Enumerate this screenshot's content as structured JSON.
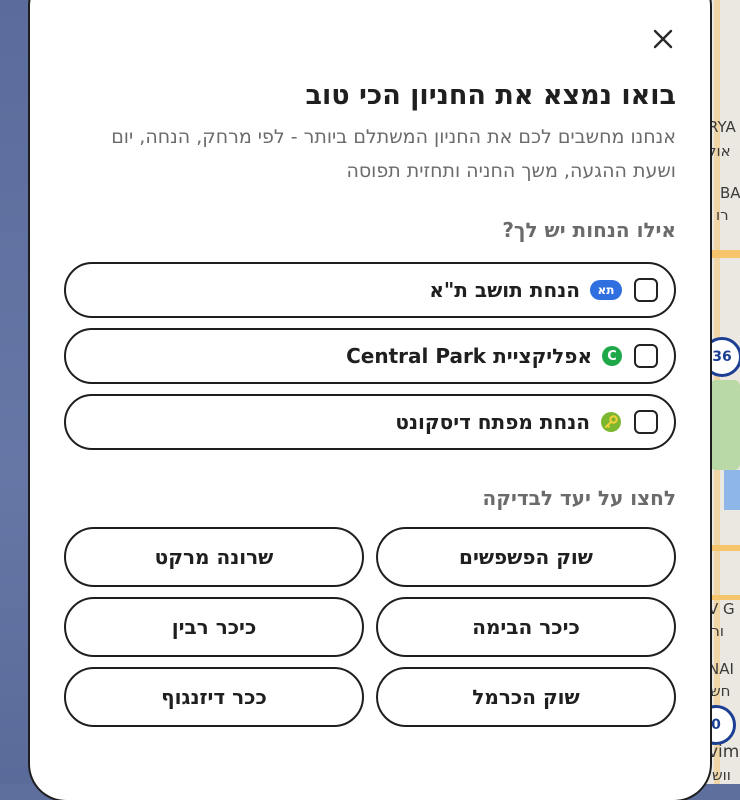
{
  "map": {
    "labels": [
      "RYA",
      "אול",
      "BA",
      "רו",
      "36",
      "V G",
      "ורי",
      "NAI",
      "חש",
      "0",
      "vim",
      "ווש"
    ]
  },
  "modal": {
    "close_icon": "close-icon",
    "title": "בואו נמצא את החניון הכי טוב",
    "subtitle": "אנחנו מחשבים לכם את החניון המשתלם ביותר - לפי מרחק, הנחה, יום ושעת ההגעה, משך החניה ותחזית תפוסה",
    "discounts_label": "אילו הנחות יש לך?",
    "discounts": [
      {
        "label": "הנחת תושב ת\"א",
        "icon": "ta-badge-icon",
        "icon_text": "תא",
        "checked": false,
        "color": "#2f6fe0"
      },
      {
        "label": "אפליקציית Central Park",
        "icon": "central-park-icon",
        "icon_text": "C",
        "checked": false,
        "color": "#1fa84a"
      },
      {
        "label": "הנחת מפתח דיסקונט",
        "icon": "key-icon",
        "checked": false,
        "color": "#7cb82f"
      }
    ],
    "destinations_label": "לחצו על יעד לבדיקה",
    "destinations": [
      {
        "label": "שוק הפשפשים"
      },
      {
        "label": "שרונה מרקט"
      },
      {
        "label": "כיכר הבימה"
      },
      {
        "label": "כיכר רבין"
      },
      {
        "label": "שוק הכרמל"
      },
      {
        "label": "ככר דיזנגוף"
      }
    ]
  }
}
